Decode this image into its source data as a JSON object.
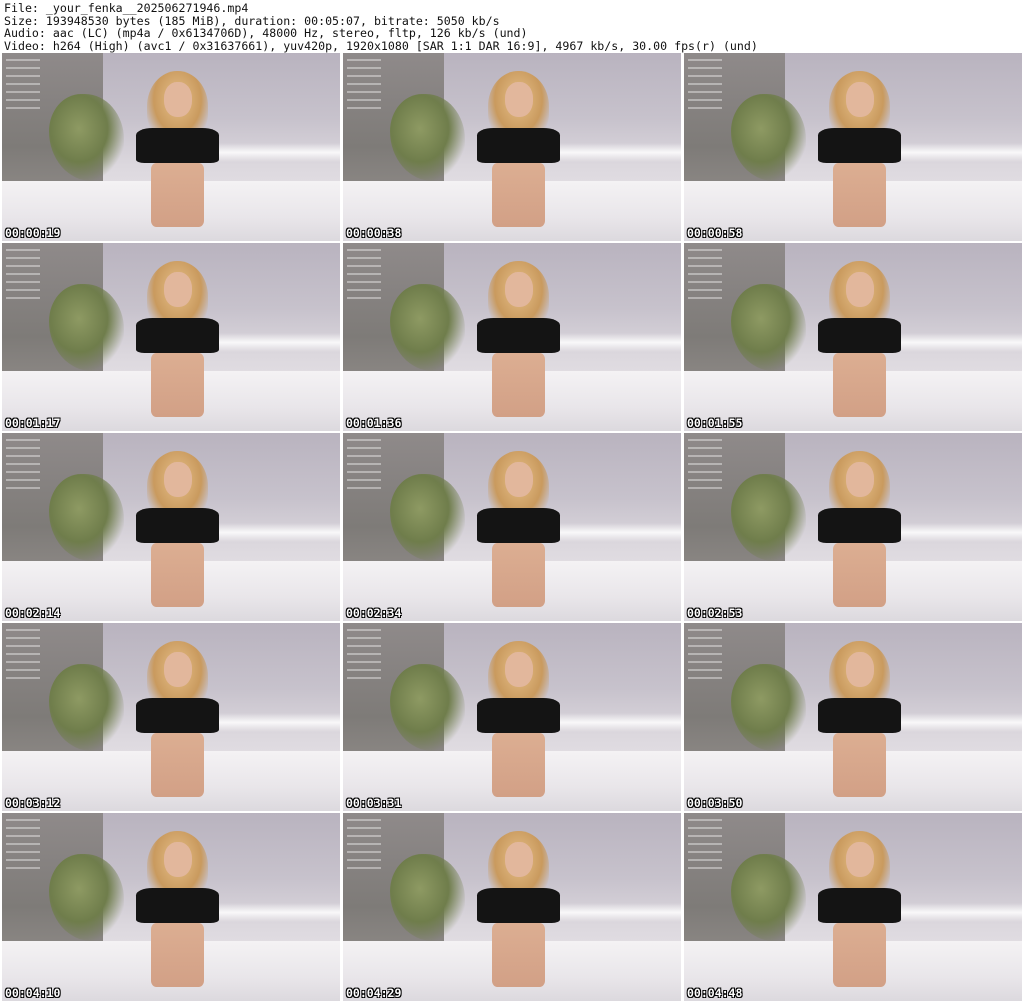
{
  "header": {
    "file": "File: _your_fenka__202506271946.mp4",
    "size": "Size: 193948530 bytes (185 MiB), duration: 00:05:07, bitrate: 5050 kb/s",
    "audio": "Audio: aac (LC) (mp4a / 0x6134706D), 48000 Hz, stereo, fltp, 126 kb/s (und)",
    "video": "Video: h264 (High) (avc1 / 0x31637661), yuv420p, 1920x1080 [SAR 1:1 DAR 16:9], 4967 kb/s, 30.00 fps(r) (und)"
  },
  "thumbnails": [
    {
      "timestamp": "00:00:19"
    },
    {
      "timestamp": "00:00:38"
    },
    {
      "timestamp": "00:00:58"
    },
    {
      "timestamp": "00:01:17"
    },
    {
      "timestamp": "00:01:36"
    },
    {
      "timestamp": "00:01:55"
    },
    {
      "timestamp": "00:02:14"
    },
    {
      "timestamp": "00:02:34"
    },
    {
      "timestamp": "00:02:53"
    },
    {
      "timestamp": "00:03:12"
    },
    {
      "timestamp": "00:03:31"
    },
    {
      "timestamp": "00:03:50"
    },
    {
      "timestamp": "00:04:10"
    },
    {
      "timestamp": "00:04:29"
    },
    {
      "timestamp": "00:04:48"
    }
  ]
}
